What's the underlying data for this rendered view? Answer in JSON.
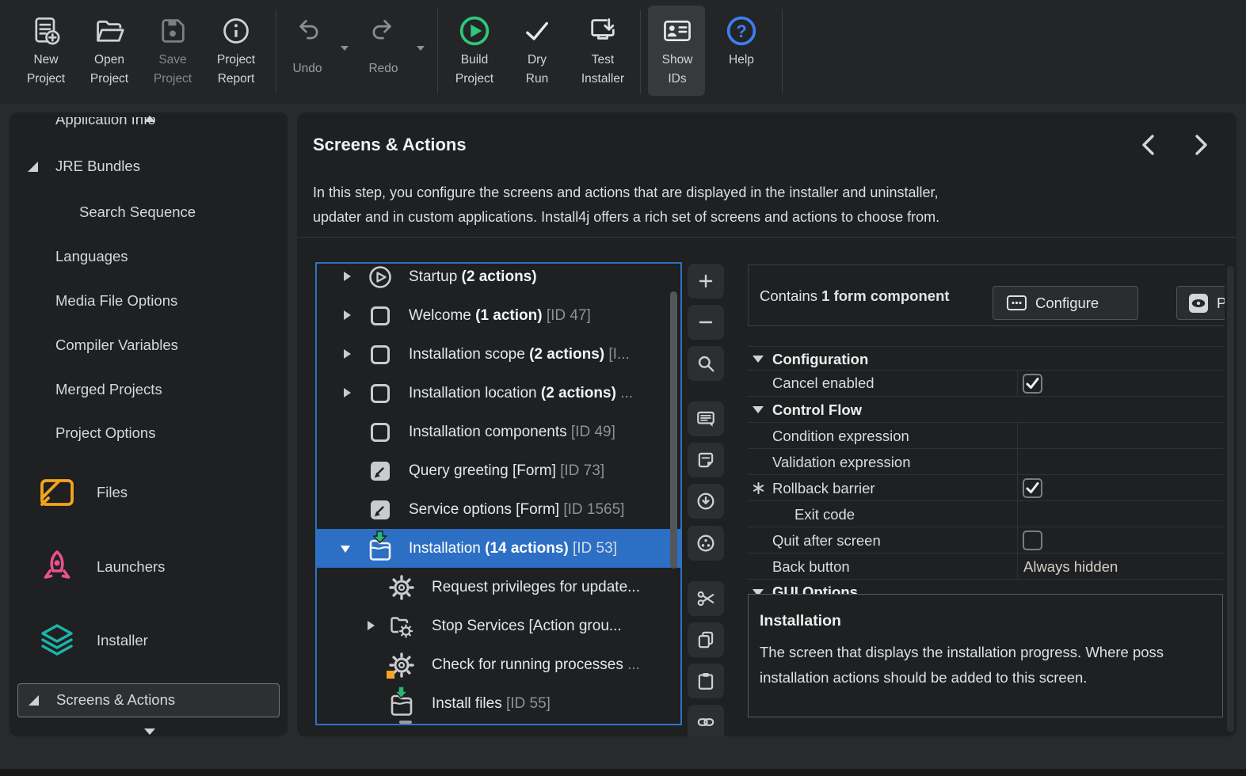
{
  "colors": {
    "selection_blue": "#2d6fc4",
    "tree_focus_border": "#2e73c8",
    "build_green": "#2fc77e",
    "arrow_green": "#2ab572",
    "help_blue": "#3f7df2",
    "files_orange": "#f2a51d",
    "launchers_pink": "#e8528e",
    "installer_teal": "#1fb3a7",
    "badge_orange": "#f5a623"
  },
  "toolbar": {
    "new_project": {
      "l1": "New",
      "l2": "Project",
      "state": "enabled"
    },
    "open_project": {
      "l1": "Open",
      "l2": "Project",
      "state": "enabled"
    },
    "save_project": {
      "l1": "Save",
      "l2": "Project",
      "state": "disabled"
    },
    "project_report": {
      "l1": "Project",
      "l2": "Report",
      "state": "enabled"
    },
    "undo": {
      "label": "Undo",
      "state": "disabled"
    },
    "redo": {
      "label": "Redo",
      "state": "disabled"
    },
    "build_project": {
      "l1": "Build",
      "l2": "Project",
      "state": "enabled"
    },
    "dry_run": {
      "l1": "Dry",
      "l2": "Run",
      "state": "enabled"
    },
    "test_installer": {
      "l1": "Test",
      "l2": "Installer",
      "state": "enabled"
    },
    "show_ids": {
      "l1": "Show",
      "l2": "IDs",
      "state": "active"
    },
    "help": {
      "label": "Help",
      "state": "enabled"
    }
  },
  "sidebar": {
    "items": [
      {
        "label": "Application Info",
        "clipped_top": true
      },
      {
        "label": "JRE Bundles",
        "expander": true
      },
      {
        "label": "Search Sequence",
        "indent": 2
      },
      {
        "label": "Languages"
      },
      {
        "label": "Media File Options"
      },
      {
        "label": "Compiler Variables"
      },
      {
        "label": "Merged Projects"
      },
      {
        "label": "Project Options"
      },
      {
        "label": "Files",
        "icon": "files"
      },
      {
        "label": "Launchers",
        "icon": "launchers"
      },
      {
        "label": "Installer",
        "icon": "installer"
      },
      {
        "label": "Screens & Actions",
        "expander": true,
        "selected": true
      }
    ]
  },
  "header": {
    "title": "Screens & Actions",
    "desc1": "In this step, you configure the screens and actions that are displayed in the installer and uninstaller,",
    "desc2": "updater and in custom applications. Install4j offers a rich set of screens and actions to choose from."
  },
  "tree": {
    "items": [
      {
        "icon": "startup-screen",
        "expander": "collapsed",
        "text": "Startup ",
        "bold": "(2 actions)"
      },
      {
        "icon": "screen",
        "expander": "collapsed",
        "text": "Welcome ",
        "bold": "(1 action)",
        "id": " [ID 47]"
      },
      {
        "icon": "screen",
        "expander": "collapsed",
        "text": "Installation scope ",
        "bold": "(2 actions)",
        "id": " [I..."
      },
      {
        "icon": "screen",
        "expander": "collapsed",
        "text": "Installation location ",
        "bold": "(2 actions)",
        "id": " ..."
      },
      {
        "icon": "screen",
        "text": "Installation components",
        "id": " [ID 49]"
      },
      {
        "icon": "form-screen",
        "text": "Query greeting [Form]",
        "id": " [ID 73]"
      },
      {
        "icon": "form-screen",
        "text": "Service options [Form]",
        "id": " [ID 1565]"
      },
      {
        "icon": "installation-folder",
        "expander": "expanded",
        "selected": true,
        "text": "Installation ",
        "bold": "(14 actions)",
        "id": " [ID 53]"
      },
      {
        "icon": "action-gear",
        "level": 2,
        "text": "Request privileges for update..."
      },
      {
        "icon": "action-group",
        "expander": "collapsed",
        "level": 2,
        "text": "Stop Services [Action grou..."
      },
      {
        "icon": "action-gear-badged",
        "level": 2,
        "text": "Check for running processes",
        "id": " ..."
      },
      {
        "icon": "installation-folder",
        "level": 2,
        "text": "Install files",
        "id": " [ID 55]"
      }
    ]
  },
  "side_toolbar": {
    "buttons": [
      {
        "icon": "plus"
      },
      {
        "icon": "minus"
      },
      {
        "icon": "magnifier"
      },
      {
        "icon": "screen-bubble"
      },
      {
        "icon": "form-note"
      },
      {
        "icon": "download-circle"
      },
      {
        "icon": "socket-circle"
      },
      {
        "icon": "scissors"
      },
      {
        "icon": "copy"
      },
      {
        "icon": "clipboard"
      },
      {
        "icon": "link"
      }
    ]
  },
  "config_panel": {
    "contains_prefix": "Contains ",
    "contains_bold": "1 form component",
    "configure_label": "Configure",
    "preview_label": "Preview"
  },
  "properties": {
    "rows": [
      {
        "type": "section",
        "label": "Configuration"
      },
      {
        "type": "checkbox",
        "label": "Cancel enabled",
        "checked": true
      },
      {
        "type": "section",
        "label": "Control Flow"
      },
      {
        "type": "text",
        "label": "Condition expression",
        "value": ""
      },
      {
        "type": "text",
        "label": "Validation expression",
        "value": ""
      },
      {
        "type": "checkbox",
        "label": "Rollback barrier",
        "checked": true,
        "marker": "*"
      },
      {
        "type": "text",
        "label": "Exit code",
        "value": "",
        "indent": true
      },
      {
        "type": "checkbox",
        "label": "Quit after screen",
        "checked": false
      },
      {
        "type": "text",
        "label": "Back button",
        "value": "Always hidden"
      },
      {
        "type": "section",
        "label": "GUI Options",
        "clipped": true
      }
    ]
  },
  "description": {
    "title": "Installation",
    "line1": "The screen that displays the installation progress. Where poss",
    "line2": "installation actions should be added to this screen."
  }
}
